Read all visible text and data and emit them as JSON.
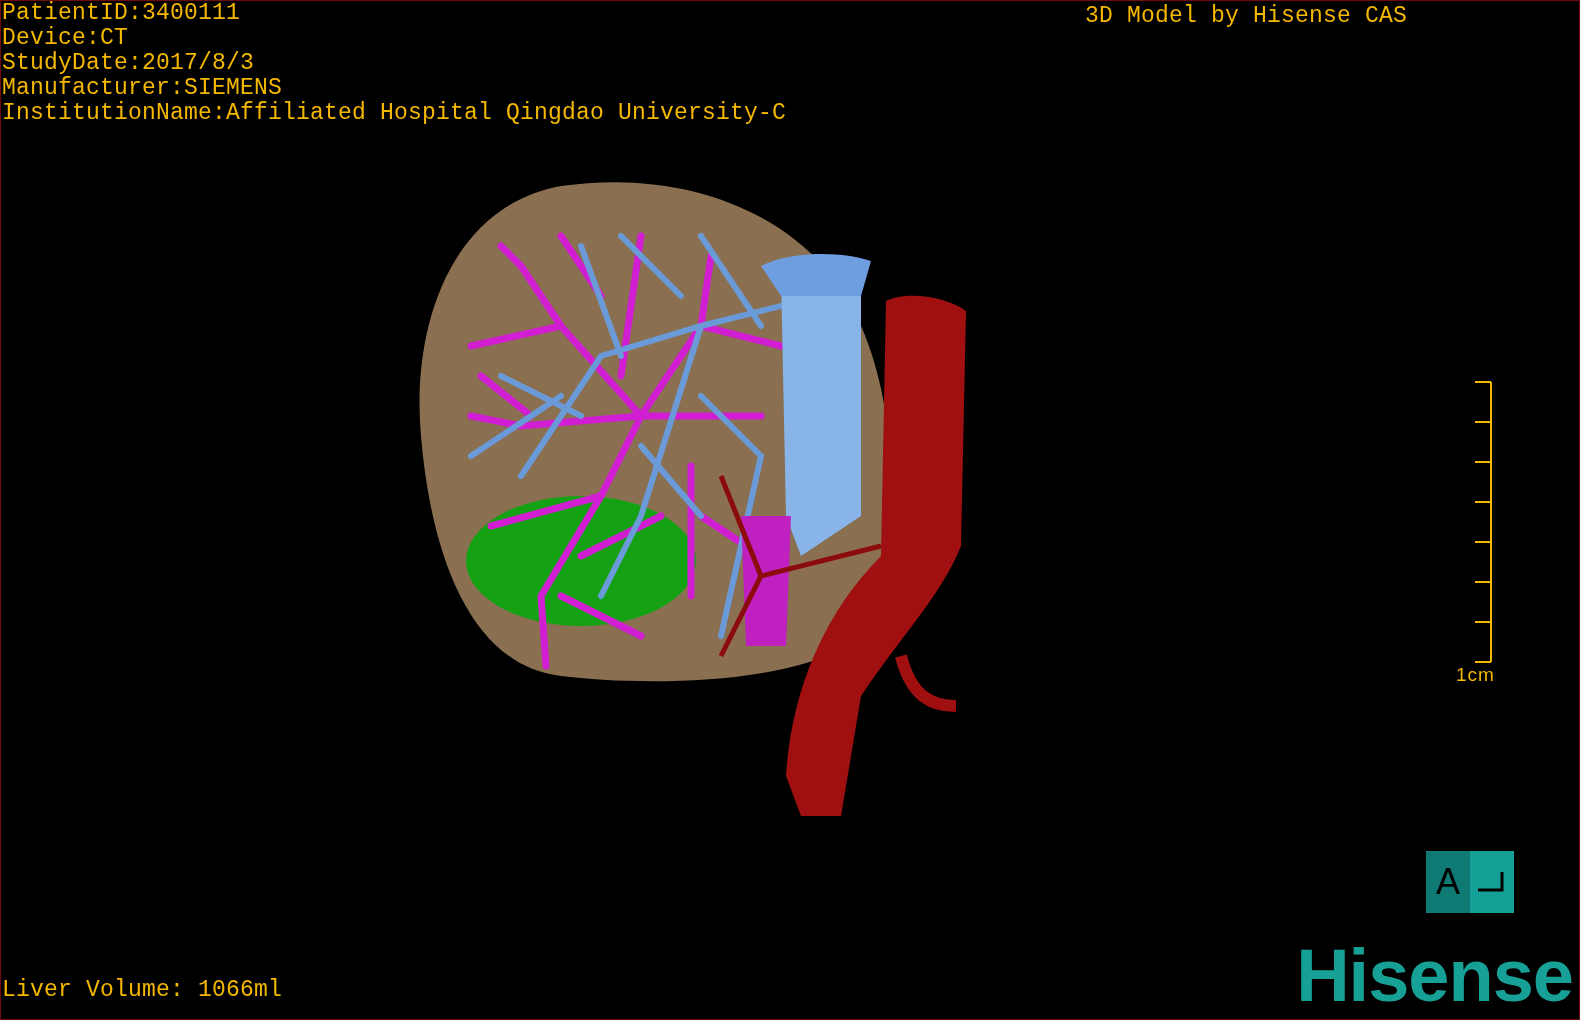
{
  "patient_info": [
    "PatientID:3400111",
    "Device:CT",
    "StudyDate:2017/8/3",
    "Manufacturer:SIEMENS",
    "InstitutionName:Affiliated Hospital Qingdao University-C"
  ],
  "title": "3D Model by Hisense CAS",
  "scale_bar": {
    "label": "1cm"
  },
  "liver_volume": "Liver Volume: 1066ml",
  "orientation_cube": {
    "label": "A"
  },
  "logo": "Hisense"
}
